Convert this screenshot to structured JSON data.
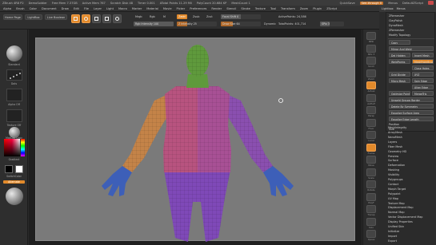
{
  "titlebar": {
    "items": [
      "ZBrush 4R8 P2",
      "DemoSoldier",
      "Free Mem 7.37GB",
      "Active Mem 767",
      "Scratch Disk 48",
      "Timer 0.001",
      "ATotal Points 11.29 Mil",
      "PolyCount 20.684 KP",
      "MeshCount 1"
    ],
    "quicksave": "QuickSave",
    "seethrough": "See-through 0",
    "menus": "Menus",
    "script": "DefaultZScript"
  },
  "menubar": {
    "items": [
      "Alpha",
      "Brush",
      "Color",
      "Document",
      "Draw",
      "Edit",
      "File",
      "Layer",
      "Light",
      "Macro",
      "Marker",
      "Material",
      "Movie",
      "Picker",
      "Preferences",
      "Render",
      "Stencil",
      "Stroke",
      "Texture",
      "Tool",
      "Transform",
      "Zoom",
      "Plugin",
      "ZScript"
    ]
  },
  "topshelf": {
    "home_page": "Home Page",
    "lightbox": "LightBox",
    "live_boolean": "Live Boolean",
    "tools": [
      "Edit",
      "Draw",
      "Move",
      "Scale",
      "Rotate"
    ],
    "modes": [
      "Mrgb",
      "Rgb",
      "M",
      "Zadd",
      "Zsub",
      "Zcut"
    ],
    "focal_shift": "Focal Shift 0",
    "draw_size": "Draw Size 64",
    "dynamic": "Dynamic",
    "rgb_intensity": "Rgb Intensity 100",
    "z_intensity": "Z Intensity 25",
    "active_points": "ActivePoints: 24,586",
    "total_points": "TotalPoints: 401,714",
    "xyz_label": "SPix 3"
  },
  "lefttray": {
    "brush": "Standard",
    "stroke": "Dots",
    "alpha": "Alpha Off",
    "texture": "Texture Off",
    "material": "MatCap Gray",
    "gradient": "Gradient",
    "switch_color": "SwitchColor",
    "alternate": "Alternate"
  },
  "rightshelf": {
    "labels": [
      "BPR",
      "SPix 3",
      "Scroll",
      "Zoom",
      "Actual",
      "AAHalf",
      "Persp",
      "Floor",
      "Local",
      "Frame",
      "Move",
      "Scale",
      "Rotate",
      "PolyF",
      "Transp",
      "Solo",
      "Xpose"
    ]
  },
  "palette": {
    "header": [
      "Lightbox",
      "Menus"
    ],
    "top_items": [
      "ZRemesher",
      "ClayPolish",
      "DynaMesh",
      "ZRemesher",
      "Modify Topology"
    ],
    "copy_label": "Copy",
    "mirror_and_weld": "Mirror And Weld",
    "del_hidden": "Del Hidden",
    "insert_mesh": "Insert Mesh",
    "weld_points": "WeldPoints",
    "mesh_from_brush": "MeshFromBrush",
    "close_holes": "Close Holes",
    "grid_divide": "Grid Divide",
    "xyz": "XYZ",
    "micro_mesh": "Micro Mesh",
    "spin_edge": "Spin Edge",
    "align_edge": "Align Edge",
    "optimize_points": "Optimize Points",
    "merge_tris": "MergeTris",
    "unweld_groups": "Unweld Groups Border",
    "delete_by_symmetry": "Delete By Symmetry",
    "equalize_surface": "Equalize Surface Area",
    "equalize_edge": "Equalize Edge Length",
    "position": "Position",
    "size": "Size",
    "mesh_integrity": "MeshIntegrity",
    "subpalettes": [
      "ArrayMesh",
      "NanoMesh",
      "Layers",
      "Fiber Mesh",
      "Geometry HD",
      "Preview",
      "Surface",
      "Deformation",
      "Masking",
      "Visibility",
      "Polygroups",
      "Contact",
      "Morph Target",
      "Polypaint",
      "UV Map",
      "Texture Map",
      "Displacement Map",
      "Normal Map",
      "Vector Displacement Map",
      "Display Properties",
      "Unified Skin",
      "Initialize",
      "Import",
      "Export"
    ]
  },
  "colors": {
    "accent": "#e28a2b",
    "head": "#5f9a3c",
    "torso": "#b8537f",
    "arm_left": "#c48348",
    "arm_right": "#8a4fb0",
    "hands": "#3d5fb8",
    "legs": "#7f49b8"
  }
}
